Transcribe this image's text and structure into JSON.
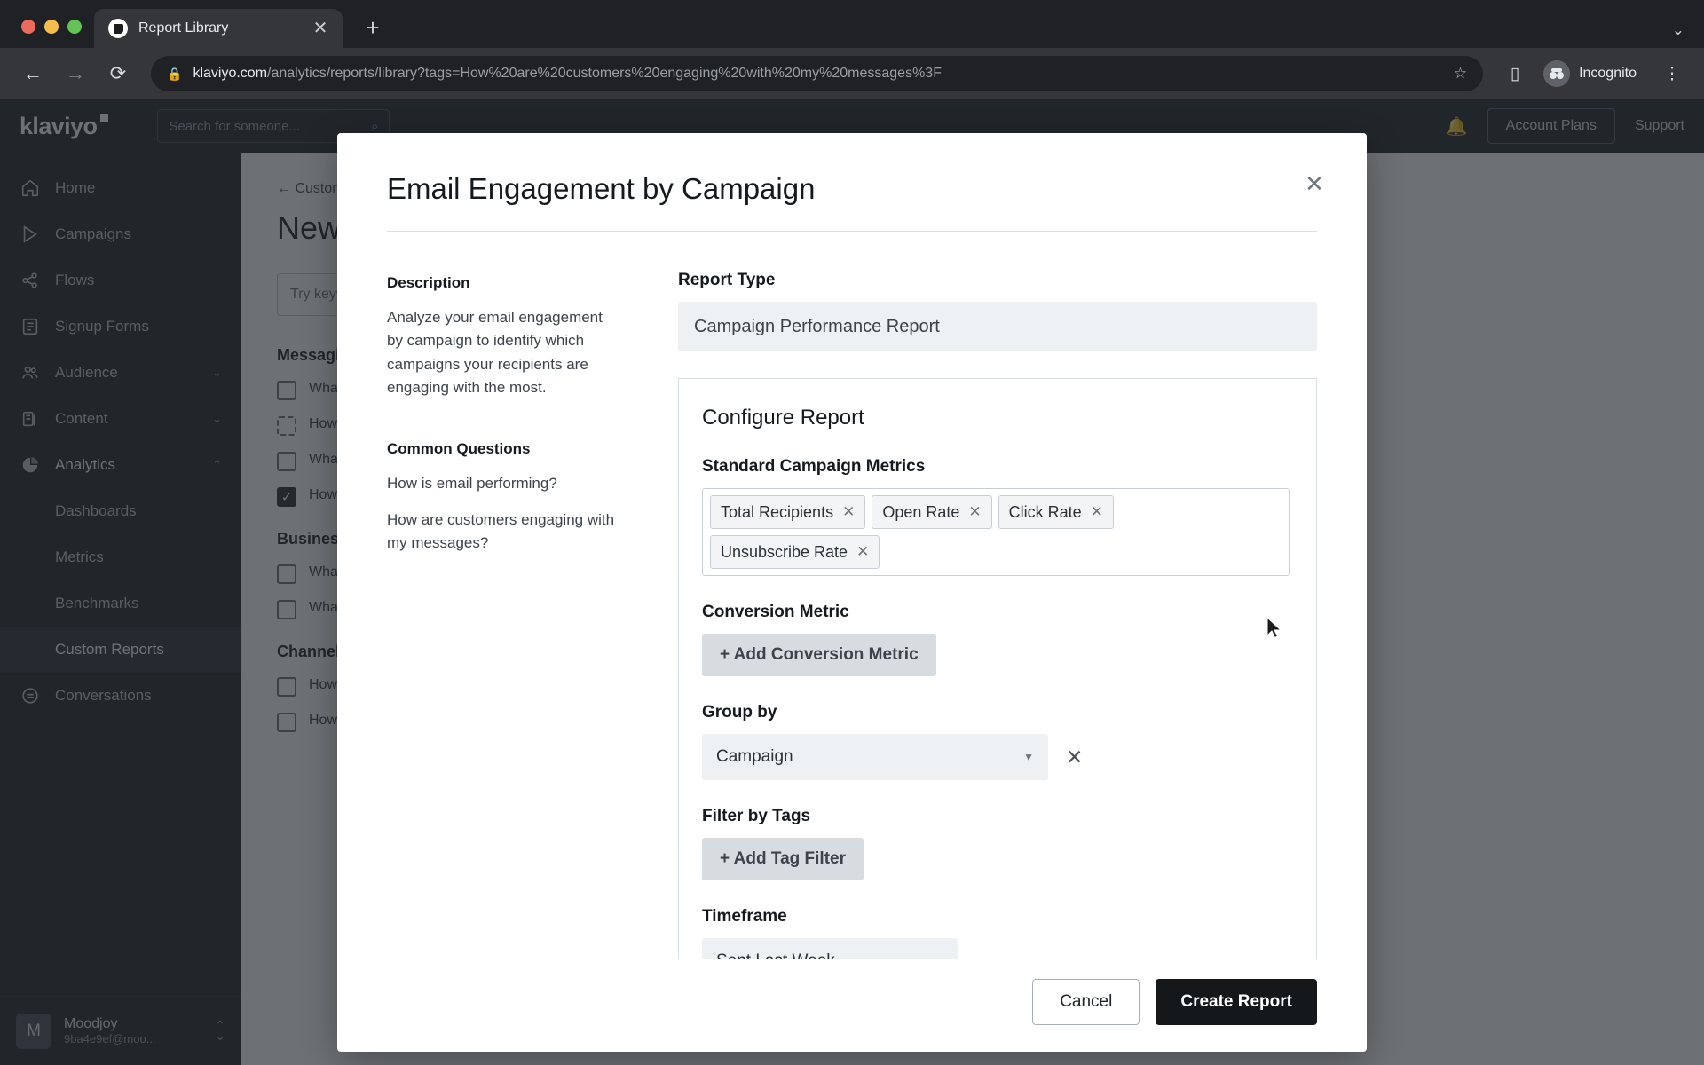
{
  "browser": {
    "tab_title": "Report Library",
    "tab_close_icon": "close-icon",
    "new_tab_icon": "plus-icon",
    "tab_list_icon": "chevron-down-icon",
    "back_icon": "arrow-left-icon",
    "forward_icon": "arrow-right-icon",
    "reload_icon": "reload-icon",
    "lock_icon": "lock-icon",
    "url_host": "klaviyo.com",
    "url_rest": "/analytics/reports/library?tags=How%20are%20customers%20engaging%20with%20my%20messages%3F",
    "bookmark_icon": "star-icon",
    "sidepanel_icon": "side-panel-icon",
    "incognito_label": "Incognito",
    "incognito_icon": "incognito-icon",
    "menu_icon": "kebab-menu-icon"
  },
  "topnav": {
    "logo": "klaviyo",
    "search_placeholder": "Search for someone...",
    "search_icon": "search-icon",
    "bell_icon": "bell-icon",
    "account_plans": "Account Plans",
    "support": "Support"
  },
  "sidebar": {
    "items": [
      {
        "label": "Home",
        "icon": "home-icon",
        "caret": ""
      },
      {
        "label": "Campaigns",
        "icon": "campaigns-icon",
        "caret": ""
      },
      {
        "label": "Flows",
        "icon": "flows-icon",
        "caret": ""
      },
      {
        "label": "Signup Forms",
        "icon": "signup-forms-icon",
        "caret": ""
      },
      {
        "label": "Audience",
        "icon": "audience-icon",
        "caret": "⌄"
      },
      {
        "label": "Content",
        "icon": "content-icon",
        "caret": "⌄"
      },
      {
        "label": "Analytics",
        "icon": "analytics-icon",
        "caret": "⌃"
      }
    ],
    "sub_items": [
      {
        "label": "Dashboards"
      },
      {
        "label": "Metrics"
      },
      {
        "label": "Benchmarks"
      },
      {
        "label": "Custom Reports"
      }
    ],
    "conversations": {
      "label": "Conversations",
      "icon": "conversations-icon"
    },
    "account": {
      "avatar_initial": "M",
      "name": "Moodjoy",
      "sub": "9ba4e9ef@moo...",
      "caret_icon": "chevron-updown-icon"
    }
  },
  "page": {
    "breadcrumb": "← Custom Reports",
    "title": "New Report",
    "search_placeholder": "Try keyword or report name",
    "search_icon": "search-icon",
    "groups": [
      {
        "title": "Messaging",
        "items": [
          {
            "label": "What is my...",
            "checked": false,
            "dashed": false
          },
          {
            "label": "How are my...",
            "checked": false,
            "dashed": true
          },
          {
            "label": "What are my deliver...",
            "checked": false,
            "dashed": false
          },
          {
            "label": "How are customers engaging with...",
            "checked": true,
            "dashed": false
          }
        ]
      },
      {
        "title": "Business",
        "items": [
          {
            "label": "What is my... time...",
            "checked": false,
            "dashed": false
          },
          {
            "label": "What is my pu...",
            "checked": false,
            "dashed": false
          }
        ]
      },
      {
        "title": "Channels",
        "items": [
          {
            "label": "How is...",
            "checked": false,
            "dashed": false
          },
          {
            "label": "How is...",
            "checked": false,
            "dashed": false
          }
        ]
      }
    ]
  },
  "modal": {
    "title": "Email Engagement by Campaign",
    "close_icon": "close-icon",
    "description_heading": "Description",
    "description_text": "Analyze your email engagement by campaign to identify which campaigns your recipients are engaging with the most.",
    "common_questions_heading": "Common Questions",
    "common_questions": [
      "How is email performing?",
      "How are customers engaging with my messages?"
    ],
    "report_type_label": "Report Type",
    "report_type_value": "Campaign Performance Report",
    "configure_heading": "Configure Report",
    "standard_metrics_label": "Standard Campaign Metrics",
    "standard_metrics": [
      {
        "label": "Total Recipients",
        "remove_icon": "close-icon"
      },
      {
        "label": "Open Rate",
        "remove_icon": "close-icon"
      },
      {
        "label": "Click Rate",
        "remove_icon": "close-icon"
      },
      {
        "label": "Unsubscribe Rate",
        "remove_icon": "close-icon"
      }
    ],
    "conversion_metric_label": "Conversion Metric",
    "add_conversion_metric": "+ Add Conversion Metric",
    "group_by_label": "Group by",
    "group_by_value": "Campaign",
    "group_by_clear_icon": "close-icon",
    "filter_tags_label": "Filter by Tags",
    "add_tag_filter": "+ Add Tag Filter",
    "timeframe_label": "Timeframe",
    "timeframe_value": "Sent Last Week",
    "cancel_label": "Cancel",
    "create_label": "Create Report"
  },
  "colors": {
    "primary_button": "#15181b",
    "sidebar_bg": "#22262b",
    "chip_bg": "#f2f4f6"
  }
}
